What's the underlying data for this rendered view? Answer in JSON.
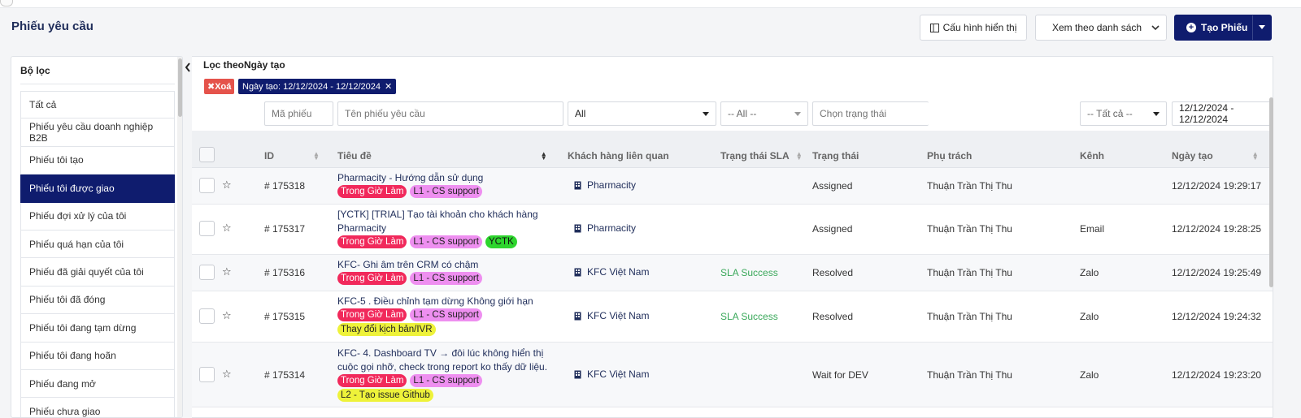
{
  "header": {
    "title": "Phiếu yêu cầu",
    "config_button": "Cấu hình hiển thị",
    "view_select": "Xem theo danh sách",
    "create_button": "Tạo Phiếu"
  },
  "sidebar": {
    "title": "Bộ lọc",
    "items": [
      {
        "label": "Tất cả",
        "active": false
      },
      {
        "label": "Phiếu yêu cầu doanh nghiệp B2B",
        "active": false
      },
      {
        "label": "Phiếu tôi tạo",
        "active": false
      },
      {
        "label": "Phiếu tôi được giao",
        "active": true
      },
      {
        "label": "Phiếu đợi xử lý của tôi",
        "active": false
      },
      {
        "label": "Phiếu quá hạn của tôi",
        "active": false
      },
      {
        "label": "Phiếu đã giải quyết của tôi",
        "active": false
      },
      {
        "label": "Phiếu tôi đã đóng",
        "active": false
      },
      {
        "label": "Phiếu tôi đang tạm dừng",
        "active": false
      },
      {
        "label": "Phiếu tôi đang hoãn",
        "active": false
      },
      {
        "label": "Phiếu đang mở",
        "active": false
      },
      {
        "label": "Phiếu chưa giao",
        "active": false
      }
    ]
  },
  "filters": {
    "label_prefix": "Lọc theo",
    "label_field": "Ngày tạo",
    "clear_chip": "Xoá",
    "date_chip": "Ngày tạo: 12/12/2024 - 12/12/2024",
    "ticket_id_placeholder": "Mã phiếu",
    "title_placeholder": "Tên phiếu yêu cầu",
    "customer_select": "All",
    "sla_select": "-- All --",
    "status_placeholder": "Chọn trạng thái",
    "channel_select": "-- Tất cả --",
    "date_range": "12/12/2024 - 12/12/2024"
  },
  "table": {
    "columns": {
      "id": "ID",
      "title": "Tiêu đề",
      "customer": "Khách hàng liên quan",
      "sla": "Trạng thái SLA",
      "status": "Trạng thái",
      "assignee": "Phụ trách",
      "channel": "Kênh",
      "created": "Ngày tạo"
    },
    "rows": [
      {
        "id": "# 175318",
        "title": "Pharmacity - Hướng dẫn sử dụng",
        "tags": [
          {
            "text": "Trong Giờ Làm",
            "color": "red"
          },
          {
            "text": "L1 - CS support",
            "color": "pink"
          }
        ],
        "customer": "Pharmacity",
        "sla": "",
        "status": "Assigned",
        "assignee": "Thuận Trần Thị Thu",
        "channel": "",
        "created": "12/12/2024 19:29:17"
      },
      {
        "id": "# 175317",
        "title": "[YCTK] [TRIAL] Tạo tài khoản cho khách hàng Pharmacity",
        "tags": [
          {
            "text": "Trong Giờ Làm",
            "color": "red"
          },
          {
            "text": "L1 - CS support",
            "color": "pink"
          },
          {
            "text": "YCTK",
            "color": "green"
          }
        ],
        "customer": "Pharmacity",
        "sla": "",
        "status": "Assigned",
        "assignee": "Thuận Trần Thị Thu",
        "channel": "Email",
        "created": "12/12/2024 19:28:25"
      },
      {
        "id": "# 175316",
        "title": "KFC- Ghi âm trên CRM có chậm",
        "tags": [
          {
            "text": "Trong Giờ Làm",
            "color": "red"
          },
          {
            "text": "L1 - CS support",
            "color": "pink"
          }
        ],
        "customer": "KFC Việt Nam",
        "sla": "SLA Success",
        "status": "Resolved",
        "assignee": "Thuận Trần Thị Thu",
        "channel": "Zalo",
        "created": "12/12/2024 19:25:49"
      },
      {
        "id": "# 175315",
        "title": "KFC-5 . Điều chỉnh tạm dừng Không giới hạn",
        "tags": [
          {
            "text": "Trong Giờ Làm",
            "color": "red"
          },
          {
            "text": "L1 - CS support",
            "color": "pink"
          },
          {
            "text": "Thay đổi kịch bản/IVR",
            "color": "yellow"
          }
        ],
        "customer": "KFC Việt Nam",
        "sla": "SLA Success",
        "status": "Resolved",
        "assignee": "Thuận Trần Thị Thu",
        "channel": "Zalo",
        "created": "12/12/2024 19:24:32"
      },
      {
        "id": "# 175314",
        "title": "KFC- 4. Dashboard TV → đôi lúc không hiển thị cuộc gọi nhỡ, check trong report ko thấy dữ liệu.",
        "tags": [
          {
            "text": "Trong Giờ Làm",
            "color": "red"
          },
          {
            "text": "L1 - CS support",
            "color": "pink"
          },
          {
            "text": "L2 - Tạo issue Github",
            "color": "yellow"
          }
        ],
        "customer": "KFC Việt Nam",
        "sla": "",
        "status": "Wait for DEV",
        "assignee": "Thuận Trần Thị Thu",
        "channel": "Zalo",
        "created": "12/12/2024 19:23:20"
      }
    ]
  }
}
